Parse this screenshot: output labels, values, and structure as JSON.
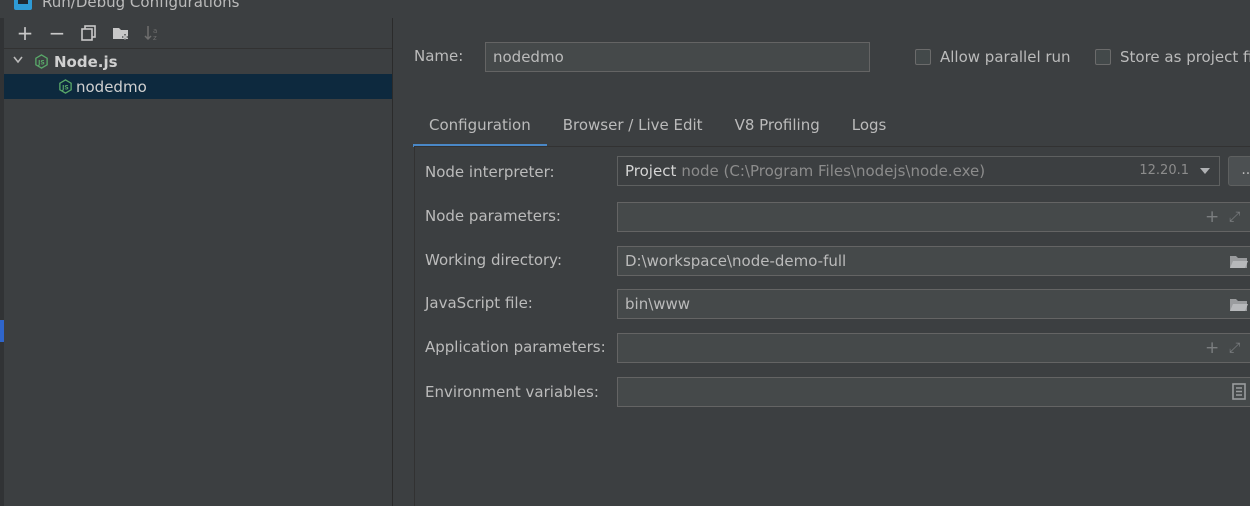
{
  "window": {
    "title": "Run/Debug Configurations"
  },
  "toolbar": {
    "add": "+",
    "remove": "−",
    "copy": "⧉",
    "folder": "▆",
    "sort": "↓a"
  },
  "tree": {
    "group": {
      "label": "Node.js",
      "icon": "nodejs-icon"
    },
    "items": [
      {
        "label": "nodedmo",
        "icon": "nodejs-icon"
      }
    ]
  },
  "form": {
    "name_label": "Name:",
    "name_value": "nodedmo",
    "allow_parallel": "Allow parallel run",
    "store_project": "Store as project fi",
    "tabs": [
      "Configuration",
      "Browser / Live Edit",
      "V8 Profiling",
      "Logs"
    ],
    "rows": {
      "interpreter_label": "Node interpreter:",
      "interpreter_project": "Project",
      "interpreter_path": "node (C:\\Program Files\\nodejs\\node.exe)",
      "interpreter_version": "12.20.1",
      "browse": "...",
      "node_params_label": "Node parameters:",
      "workdir_label": "Working directory:",
      "workdir_value": "D:\\workspace\\node-demo-full",
      "jsfile_label": "JavaScript file:",
      "jsfile_value": "bin\\www",
      "app_params_label": "Application parameters:",
      "env_label": "Environment variables:"
    }
  },
  "colors": {
    "background": "#3c3f41",
    "field": "#45494a",
    "selection": "#0d293e",
    "accent": "#4a88c7",
    "nodejs": "#59a869"
  }
}
